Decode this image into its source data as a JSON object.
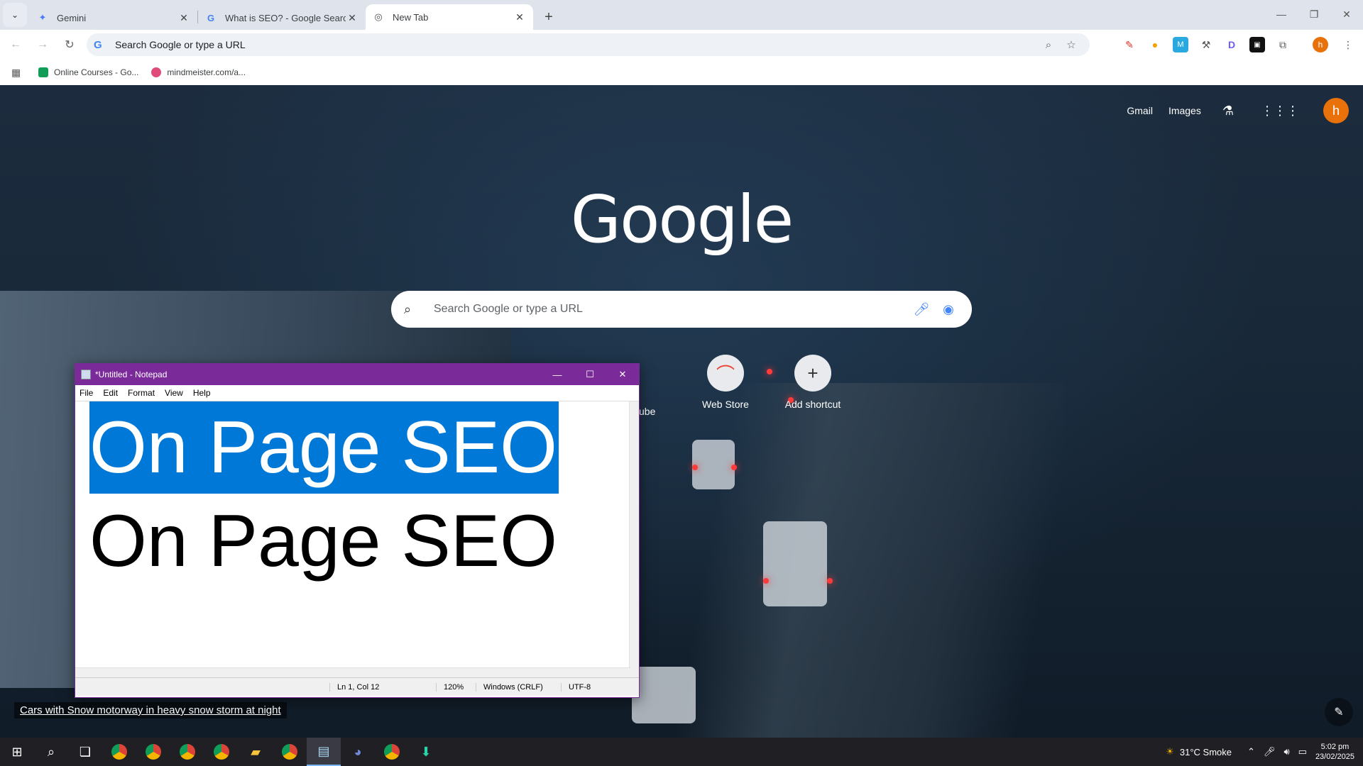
{
  "browser": {
    "tabs": [
      {
        "label": "Gemini",
        "icon": "gemini-sparkle-icon",
        "active": false
      },
      {
        "label": "What is SEO? - Google Search",
        "icon": "google-g-icon",
        "active": false
      },
      {
        "label": "New Tab",
        "icon": "chrome-icon",
        "active": true
      }
    ],
    "address": "Search Google or type a URL"
  },
  "bookmarks": [
    {
      "label": "Online Courses - Go...",
      "color": "#0f9d58"
    },
    {
      "label": "mindmeister.com/a...",
      "color": "#e04b7a"
    }
  ],
  "newtab": {
    "links": {
      "gmail": "Gmail",
      "images": "Images"
    },
    "avatar_letter": "h",
    "logo": "Google",
    "search_placeholder": "Search Google or type a URL",
    "shortcuts": {
      "partial_label": "ube",
      "webstore": "Web Store",
      "add": "Add shortcut"
    },
    "caption": "Cars with Snow motorway in heavy snow storm at night"
  },
  "notepad": {
    "title": "*Untitled - Notepad",
    "menu": [
      "File",
      "Edit",
      "Format",
      "View",
      "Help"
    ],
    "lines": [
      "On Page SEO",
      "On Page SEO"
    ],
    "status": {
      "position": "Ln 1, Col 12",
      "zoom": "120%",
      "line_endings": "Windows (CRLF)",
      "encoding": "UTF-8"
    }
  },
  "taskbar": {
    "weather": "31°C  Smoke",
    "time": "5:02 pm",
    "date": "23/02/2025"
  },
  "colors": {
    "notepad_titlebar": "#7b2a9a",
    "selection": "#0078d7",
    "avatar": "#e8710a"
  }
}
